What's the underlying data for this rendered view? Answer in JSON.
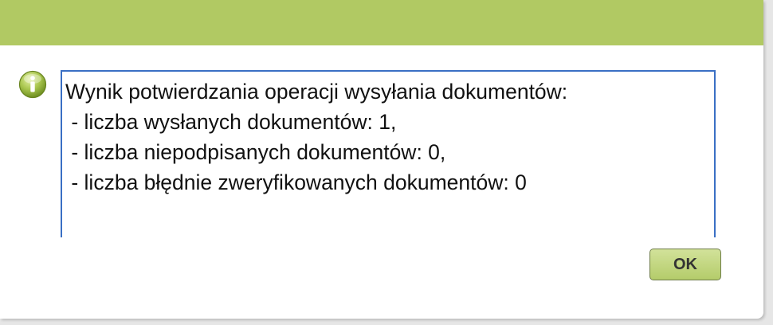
{
  "dialog": {
    "icon": "info-icon",
    "message_lines": [
      "Wynik potwierdzania operacji wysyłania dokumentów:",
      " - liczba wysłanych dokumentów: 1,",
      " - liczba niepodpisanych dokumentów: 0,",
      " - liczba błędnie zweryfikowanych dokumentów: 0"
    ],
    "ok_label": "OK"
  },
  "colors": {
    "titlebar": "#b1c963",
    "button": "#c4d882",
    "focus_border": "#3a6fc4"
  }
}
